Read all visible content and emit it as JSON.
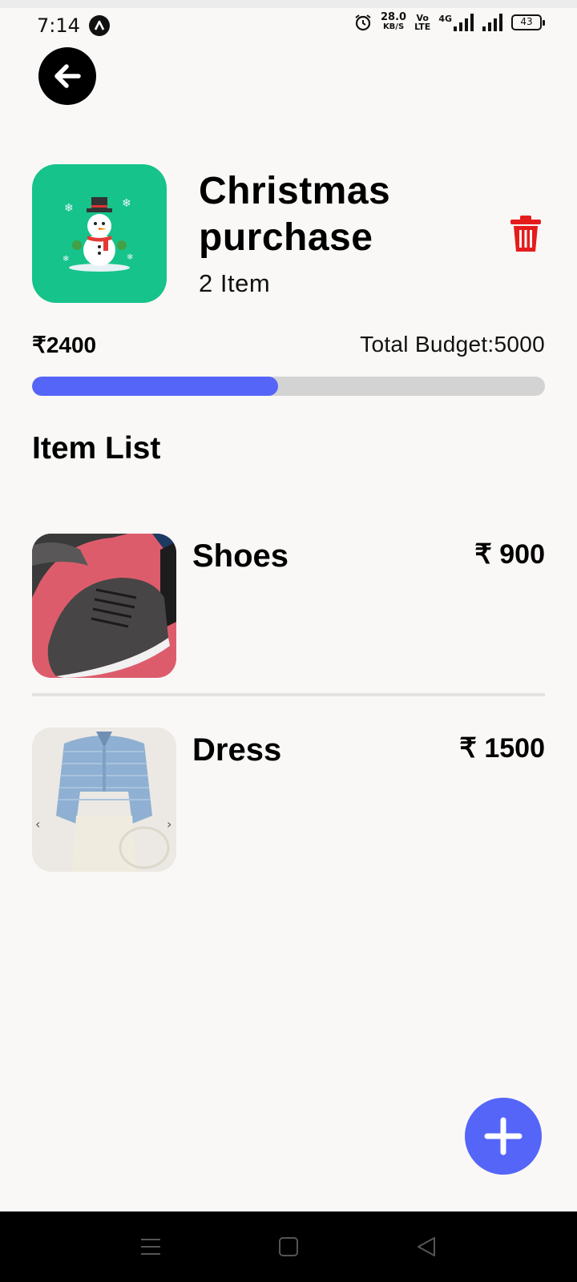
{
  "status_bar": {
    "time": "7:14",
    "net_speed_value": "28.0",
    "net_speed_unit": "KB/S",
    "volte_top": "Vo",
    "volte_bottom": "LTE",
    "network_type": "4G",
    "battery": "43"
  },
  "header": {
    "list_title": "Christmas purchase",
    "item_count": "2 Item",
    "category_emoji": "⛄"
  },
  "budget": {
    "spent": "₹2400",
    "total_label": "Total Budget:5000",
    "progress_fraction": 0.48
  },
  "section_title": "Item List",
  "items": [
    {
      "name": "Shoes",
      "price": "₹ 900"
    },
    {
      "name": "Dress",
      "price": "₹ 1500"
    }
  ],
  "icons": {
    "back": "arrow-left-icon",
    "delete": "trash-icon",
    "add": "plus-icon"
  },
  "colors": {
    "background": "#f9f8f6",
    "accent": "#5565f8",
    "category_bg": "#16c38a",
    "delete": "#e51c1c",
    "progress_track": "#d4d3d3"
  }
}
